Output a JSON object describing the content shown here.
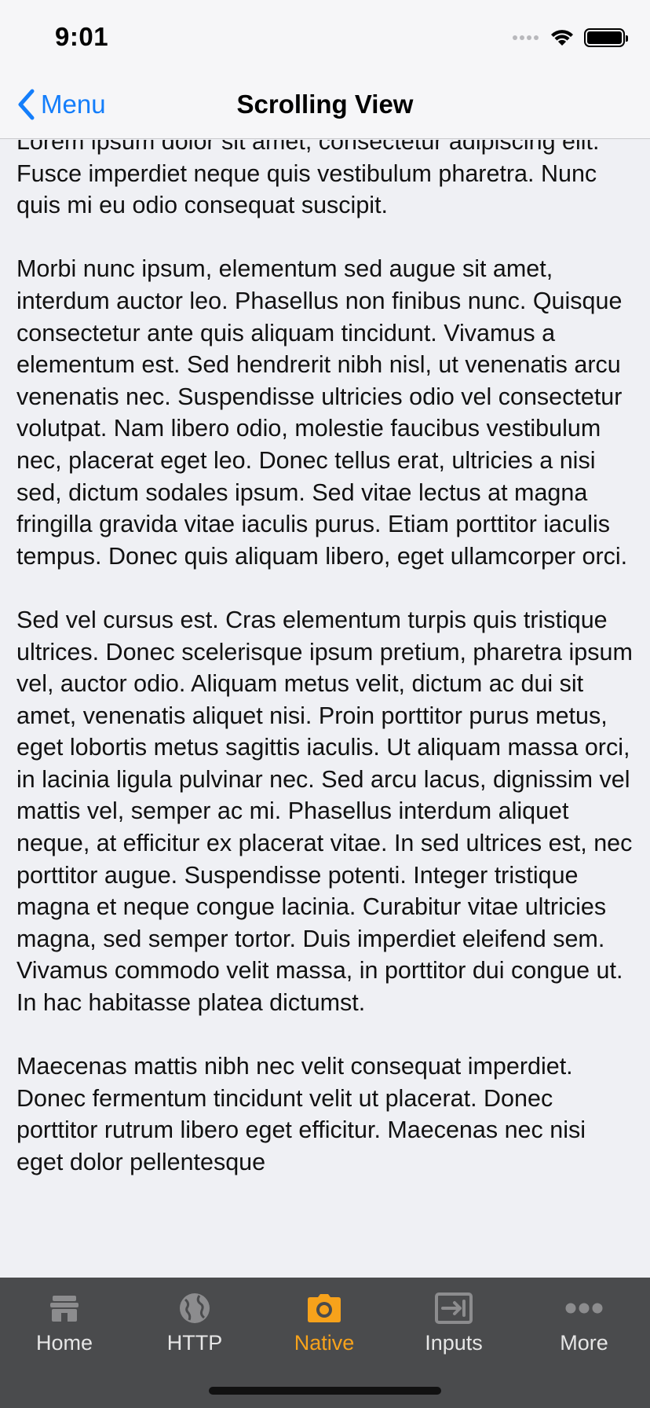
{
  "status_bar": {
    "time": "9:01"
  },
  "nav": {
    "back_label": "Menu",
    "title": "Scrolling View"
  },
  "content": {
    "paragraphs": [
      "Lorem ipsum dolor sit amet, consectetur adipiscing elit. Fusce imperdiet neque quis vestibulum pharetra. Nunc quis mi eu odio consequat suscipit.",
      "Morbi nunc ipsum, elementum sed augue sit amet, interdum auctor leo. Phasellus non finibus nunc. Quisque consectetur ante quis aliquam tincidunt. Vivamus a elementum est. Sed hendrerit nibh nisl, ut venenatis arcu venenatis nec. Suspendisse ultricies odio vel consectetur volutpat. Nam libero odio, molestie faucibus vestibulum nec, placerat eget leo. Donec tellus erat, ultricies a nisi sed, dictum sodales ipsum. Sed vitae lectus at magna fringilla gravida vitae iaculis purus. Etiam porttitor iaculis tempus. Donec quis aliquam libero, eget ullamcorper orci.",
      "Sed vel cursus est. Cras elementum turpis quis tristique ultrices. Donec scelerisque ipsum pretium, pharetra ipsum vel, auctor odio. Aliquam metus velit, dictum ac dui sit amet, venenatis aliquet nisi. Proin porttitor purus metus, eget lobortis metus sagittis iaculis. Ut aliquam massa orci, in lacinia ligula pulvinar nec. Sed arcu lacus, dignissim vel mattis vel, semper ac mi. Phasellus interdum aliquet neque, at efficitur ex placerat vitae. In sed ultrices est, nec porttitor augue. Suspendisse potenti. Integer tristique magna et neque congue lacinia. Curabitur vitae ultricies magna, sed semper tortor. Duis imperdiet eleifend sem. Vivamus commodo velit massa, in porttitor dui congue ut. In hac habitasse platea dictumst.",
      "Maecenas mattis nibh nec velit consequat imperdiet. Donec fermentum tincidunt velit ut placerat. Donec porttitor rutrum libero eget efficitur. Maecenas nec nisi eget dolor pellentesque"
    ]
  },
  "tab_bar": {
    "tabs": [
      {
        "label": "Home",
        "icon": "home-icon"
      },
      {
        "label": "HTTP",
        "icon": "globe-icon"
      },
      {
        "label": "Native",
        "icon": "camera-icon"
      },
      {
        "label": "Inputs",
        "icon": "input-icon"
      },
      {
        "label": "More",
        "icon": "more-icon"
      }
    ],
    "active_index": 2
  },
  "colors": {
    "accent": "#147efb",
    "tab_active": "#f7a21b",
    "tab_inactive": "#e6e6e6",
    "tab_bar_bg": "#4a4b4d",
    "content_bg": "#eff0f4"
  }
}
